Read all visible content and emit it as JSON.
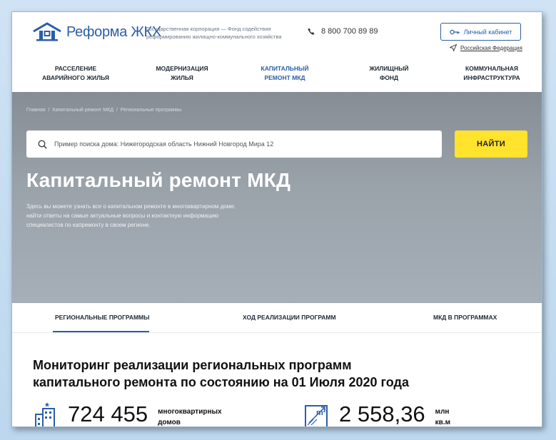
{
  "header": {
    "logo_text": "Реформа ЖКХ",
    "corp_line1": "Государственная корпорация — Фонд содействия",
    "corp_line2": "реформированию жилищно-коммунального хозяйства",
    "phone": "8 800 700 89 89",
    "cabinet_label": "Личный кабинет",
    "region": "Российская Федерация"
  },
  "nav": [
    {
      "line1": "РАССЕЛЕНИЕ",
      "line2": "АВАРИЙНОГО ЖИЛЬЯ"
    },
    {
      "line1": "МОДЕРНИЗАЦИЯ",
      "line2": "ЖИЛЬЯ"
    },
    {
      "line1": "КАПИТАЛЬНЫЙ",
      "line2": "РЕМОНТ МКД"
    },
    {
      "line1": "ЖИЛИЩНЫЙ",
      "line2": "ФОНД"
    },
    {
      "line1": "КОММУНАЛЬНАЯ",
      "line2": "ИНФРАСТРУКТУРА"
    }
  ],
  "breadcrumb": [
    "Главная",
    "Капитальный ремонт МКД",
    "Региональные программы"
  ],
  "search": {
    "placeholder": "Пример поиска дома: Нижегородская область Нижний Новгород Мира 12",
    "button": "НАЙТИ"
  },
  "hero": {
    "title": "Капитальный ремонт МКД",
    "desc_line1": "Здесь вы можете узнать все о капитальном ремонте в многоквартирном доме:",
    "desc_line2": "найти ответы на самые актуальные вопросы и контактную информацию",
    "desc_line3": "специалистов по капремонту в своем регионе."
  },
  "tabs": [
    "РЕГИОНАЛЬНЫЕ ПРОГРАММЫ",
    "ХОД РЕАЛИЗАЦИИ ПРОГРАММ",
    "МКД В ПРОГРАММАХ"
  ],
  "monitoring": {
    "title_line1": "Мониторинг реализации региональных программ",
    "title_line2": "капитального ремонта по состоянию на 01 Июля 2020 года",
    "stats": [
      {
        "value": "724 455",
        "unit_line1": "многоквартирных",
        "unit_line2": "домов"
      },
      {
        "value": "2 558,36",
        "unit_line1": "млн",
        "unit_line2": "кв.м",
        "icon_label": "m²"
      }
    ]
  },
  "colors": {
    "brand_blue": "#2b5ea8",
    "accent_yellow": "#ffe32c"
  }
}
